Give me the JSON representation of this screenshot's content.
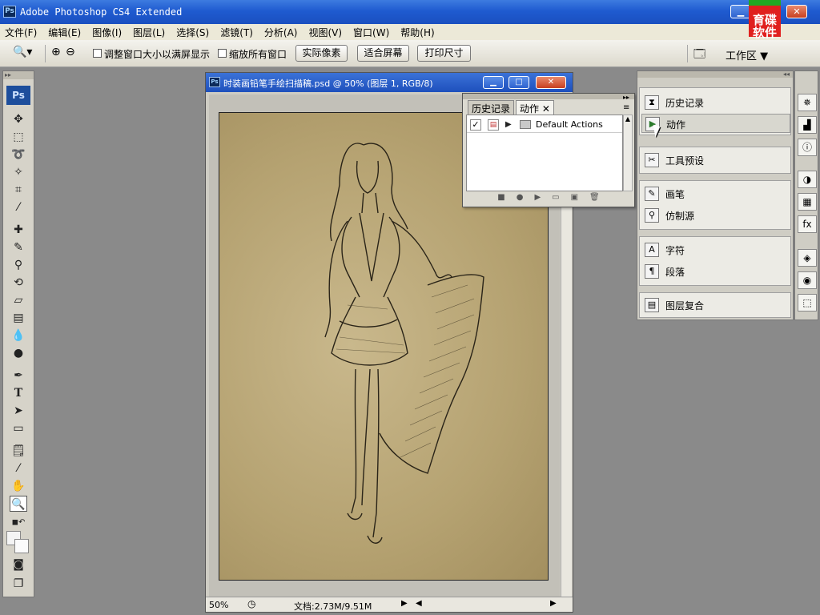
{
  "window": {
    "title": "Adobe Photoshop CS4 Extended",
    "min": "▁",
    "max": "□",
    "close": "✕"
  },
  "logo": {
    "line1": "育碟",
    "line2": "软件"
  },
  "menu": [
    "文件(F)",
    "编辑(E)",
    "图像(I)",
    "图层(L)",
    "选择(S)",
    "滤镜(T)",
    "分析(A)",
    "视图(V)",
    "窗口(W)",
    "帮助(H)"
  ],
  "options": {
    "chk1": "调整窗口大小以满屏显示",
    "chk2": "缩放所有窗口",
    "btn_actual": "实际像素",
    "btn_fit": "适合屏幕",
    "btn_print": "打印尺寸",
    "workspace": "工作区 ▼"
  },
  "document": {
    "title": "时装画铅笔手绘扫描稿.psd @ 50% (图层 1, RGB/8)",
    "zoom": "50%",
    "docsize": "文档:2.73M/9.51M"
  },
  "actions_panel": {
    "tabs": [
      "历史记录",
      "动作"
    ],
    "row_label": "Default Actions"
  },
  "dock": {
    "items": [
      "历史记录",
      "动作",
      "工具预设",
      "画笔",
      "仿制源",
      "字符",
      "段落",
      "图层复合"
    ]
  }
}
